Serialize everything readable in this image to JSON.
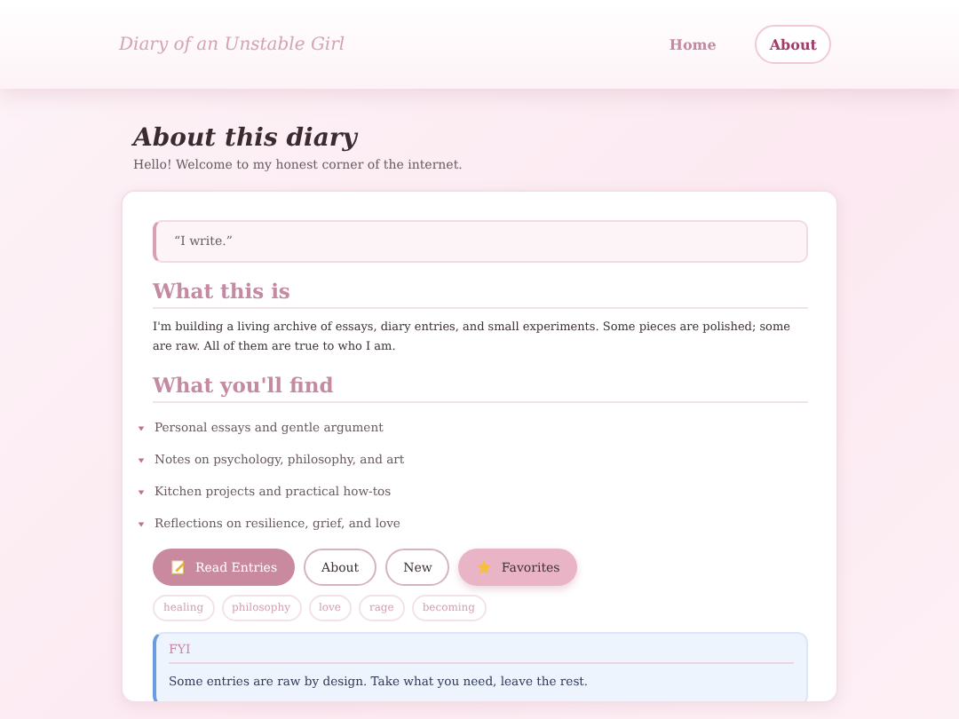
{
  "header": {
    "logo": "Diary of an Unstable Girl",
    "nav": [
      {
        "label": "Home",
        "selected": false
      },
      {
        "label": "About",
        "selected": true
      }
    ]
  },
  "intro": {
    "title": "About this diary",
    "subtitle": "Hello! Welcome to my honest corner of the internet."
  },
  "card": {
    "quote": "“I write.”",
    "sections": [
      {
        "heading": "What this is",
        "kind": "paragraph",
        "text": "I'm building a living archive of essays, diary entries, and small experiments. Some pieces are polished; some are raw. All of them are true to who I am."
      },
      {
        "heading": "What you'll find",
        "kind": "list",
        "items": [
          "Personal essays and gentle argument",
          "Notes on psychology, philosophy, and art",
          "Kitchen projects and practical how-tos",
          "Reflections on resilience, grief, and love"
        ]
      }
    ],
    "buttons": [
      {
        "label": "Read Entries",
        "kind": "primary"
      },
      {
        "label": "About",
        "kind": "outline"
      },
      {
        "label": "New",
        "kind": "outline"
      },
      {
        "label": "Favorites",
        "kind": "accent"
      }
    ],
    "tags": [
      "healing",
      "philosophy",
      "love",
      "rage",
      "becoming"
    ],
    "note": {
      "title": "FYI",
      "text": "Some entries are raw by design. Take what you need, leave the rest."
    }
  }
}
